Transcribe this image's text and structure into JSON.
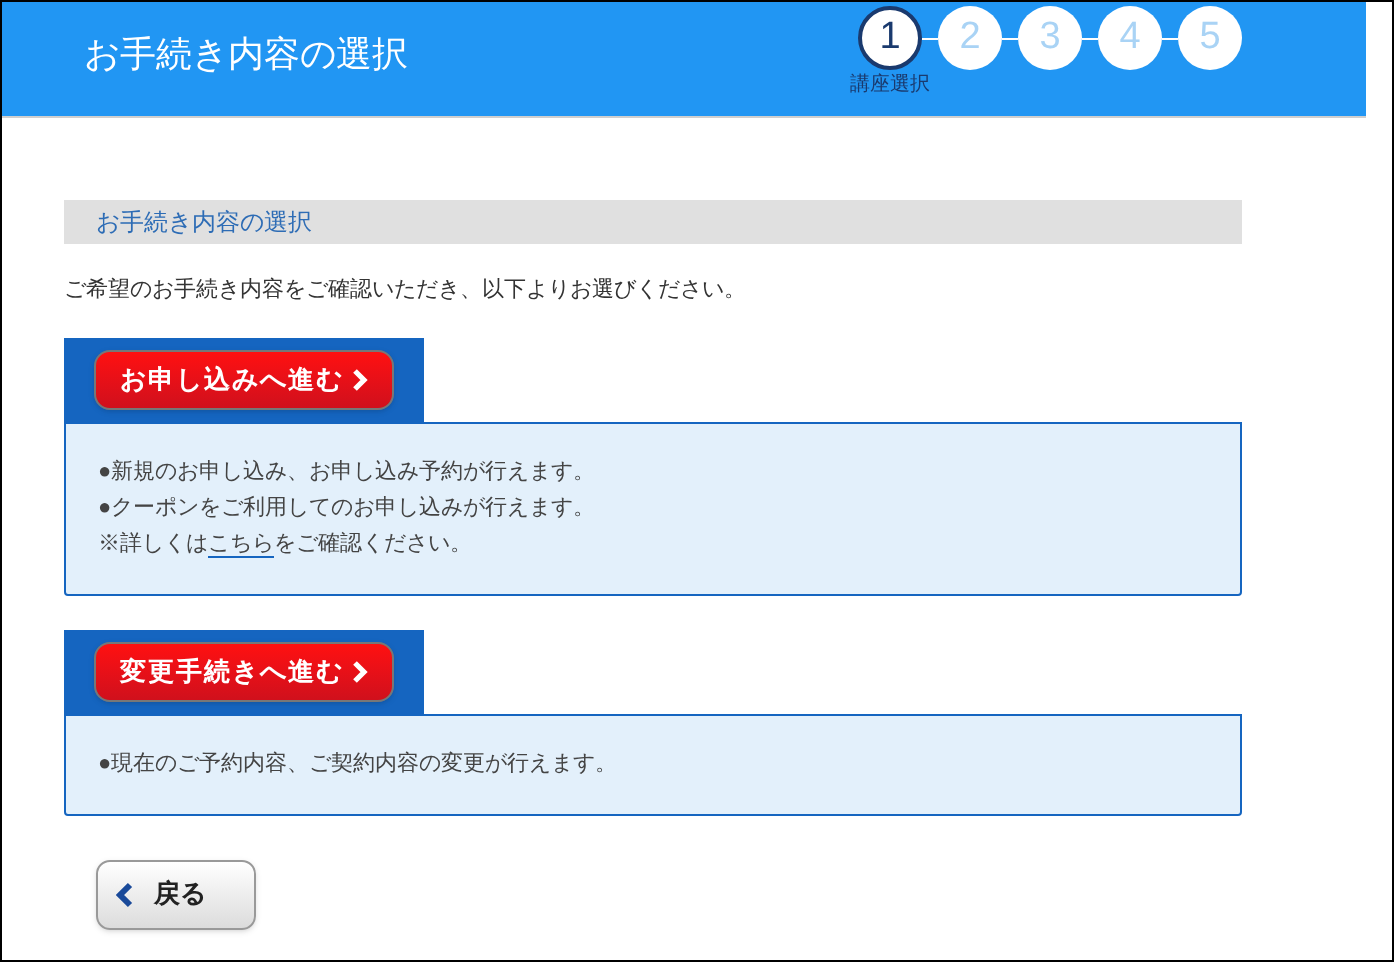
{
  "header": {
    "title": "お手続き内容の選択",
    "steps": [
      {
        "number": "1",
        "selected": true,
        "label": "講座選択"
      },
      {
        "number": "2",
        "selected": false
      },
      {
        "number": "3",
        "selected": false
      },
      {
        "number": "4",
        "selected": false
      },
      {
        "number": "5",
        "selected": false
      }
    ]
  },
  "section_heading": "お手続き内容の選択",
  "intro": "ご希望のお手続き内容をご確認いただき、以下よりお選びください。",
  "options": [
    {
      "button": "お申し込みへ進む",
      "lines": [
        {
          "text": "●新規のお申し込み、お申し込み予約が行えます。"
        },
        {
          "text": "●クーポンをご利用してのお申し込みが行えます。"
        },
        {
          "text": "※詳しくは",
          "link": "こちら",
          "after": "をご確認ください。"
        }
      ]
    },
    {
      "button": "変更手続きへ進む",
      "lines": [
        {
          "text": "●現在のご予約内容、ご契約内容の変更が行えます。"
        }
      ]
    }
  ],
  "back_button": "戻る"
}
